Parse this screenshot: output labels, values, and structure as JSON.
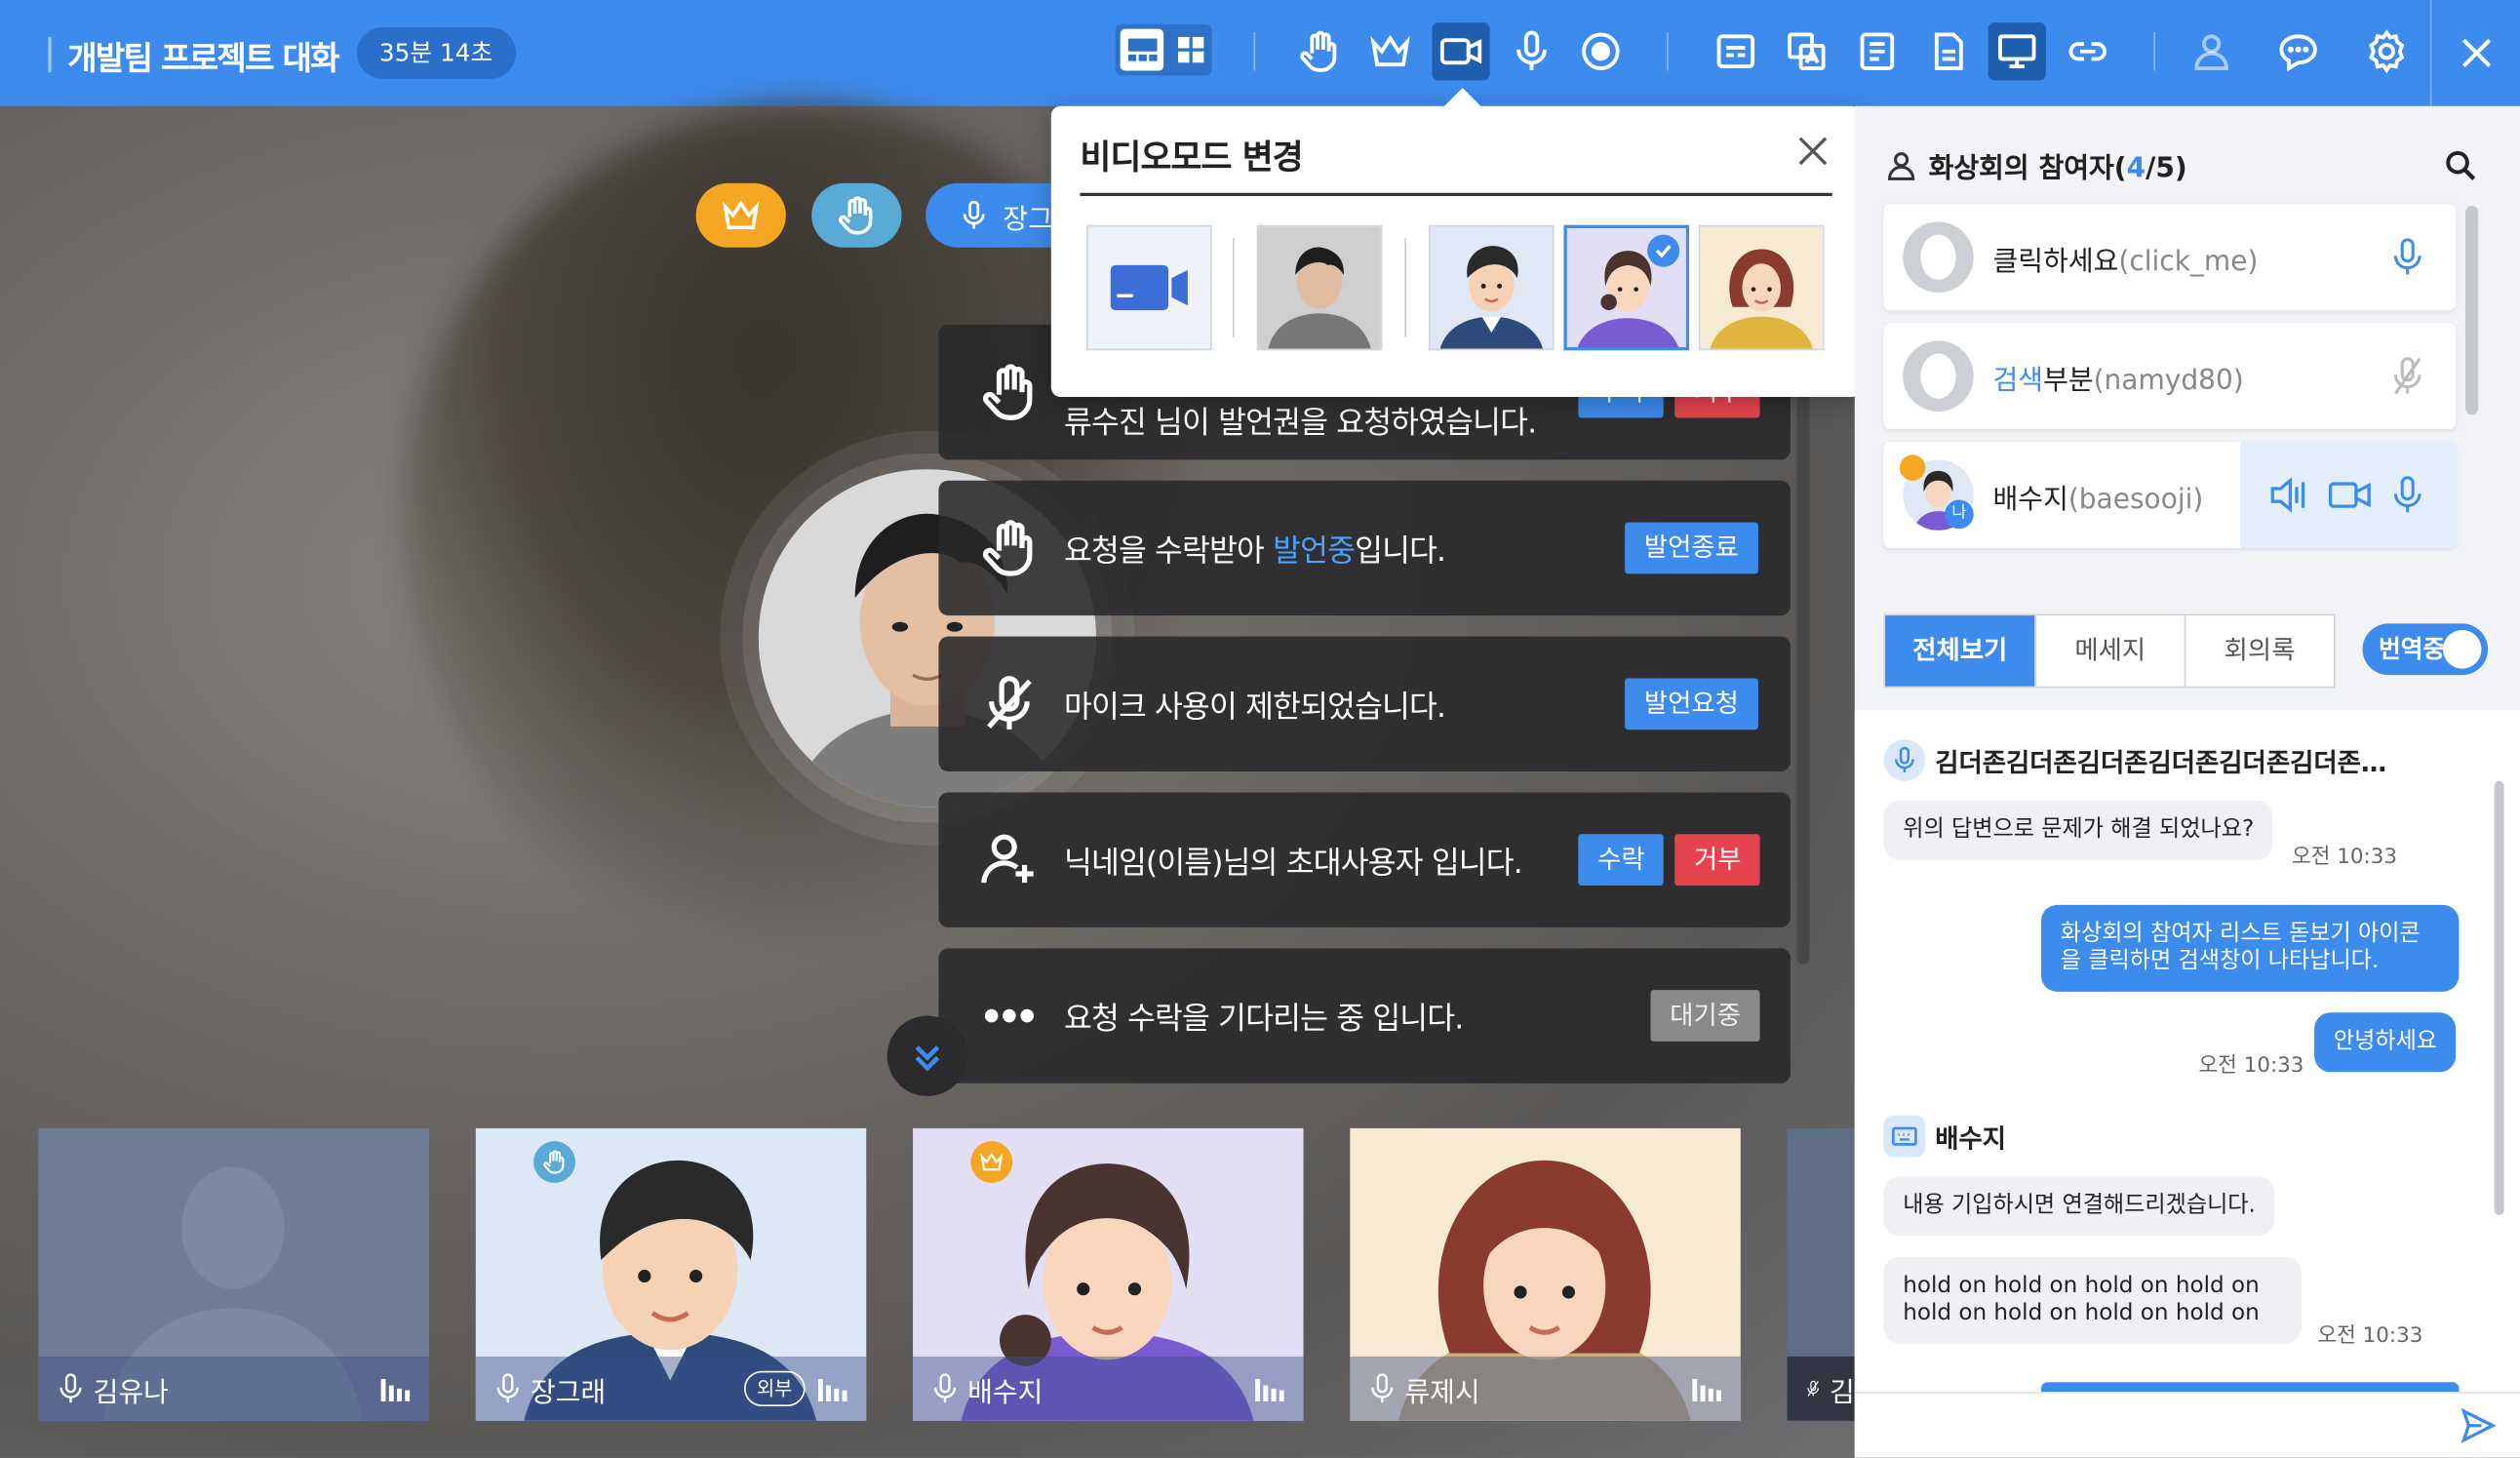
{
  "header": {
    "title": "개발팀 프로젝트 대화",
    "elapsed": "35분 14초"
  },
  "notifications": [
    {
      "text": "류수진 님이 발언권을 요청하였습니다.",
      "icon": "hand-icon",
      "buttons": [
        "수락",
        "거부"
      ]
    },
    {
      "text_before": "요청을 수락받아 ",
      "text_highlight": "발언중",
      "text_after": "입니다.",
      "icon": "hand-icon",
      "buttons": [
        "발언종료"
      ]
    },
    {
      "text": "마이크 사용이 제한되었습니다.",
      "icon": "mic-off-icon",
      "buttons": [
        "발언요청"
      ]
    },
    {
      "text": "닉네임(이름)님의 초대사용자 입니다.",
      "icon": "add-user-icon",
      "buttons": [
        "수락",
        "거부"
      ]
    },
    {
      "text": "요청 수락을 기다리는 중 입니다.",
      "icon": "more-dots-icon",
      "buttons": [
        "대기중"
      ]
    }
  ],
  "speaker_chip": {
    "label": "장그"
  },
  "video_mode_popup": {
    "title": "비디오모드 변경",
    "options": [
      "camera-icon",
      "photo",
      "avatar-male",
      "avatar-female-selected",
      "avatar-female-2"
    ]
  },
  "thumbnails": [
    {
      "name": "김유나"
    },
    {
      "name": "장그래",
      "tag": "외부"
    },
    {
      "name": "배수지"
    },
    {
      "name": "류제시"
    },
    {
      "name": "김"
    }
  ],
  "participants": {
    "title": "화상회의 참여자(",
    "count": "4",
    "total": "/5)",
    "list": [
      {
        "name": "클릭하세요",
        "id": "(click_me)"
      },
      {
        "name_highlight": "검색",
        "name_rest": "부분",
        "id": "(namyd80)"
      },
      {
        "name": "배수지",
        "id": "(baesooji)",
        "me_badge": "나"
      }
    ]
  },
  "tabs": [
    "전체보기",
    "메세지",
    "회의록"
  ],
  "translate_toggle": "번역중",
  "chat": {
    "sender1": "김더존김더존김더존김더존김더존김더존…",
    "msg1": "위의 답변으로 문제가 해결 되었나요?",
    "time1": "오전 10:33",
    "out1": "화상회의 참여자 리스트 돋보기 아이콘을 클릭하면 검색창이 나타납니다.",
    "out2": "안녕하세요",
    "time2": "오전 10:33",
    "sender2": "배수지",
    "msg2": "내용 기입하시면 연결해드리겠습니다.",
    "msg3": "hold on hold on hold on hold on hold on hold on hold on hold on",
    "time3": "오전 10:33"
  },
  "colors": {
    "primary": "#3d8bed",
    "danger": "#e5444e",
    "crown": "#f5a623",
    "hand": "#5aaad8"
  }
}
